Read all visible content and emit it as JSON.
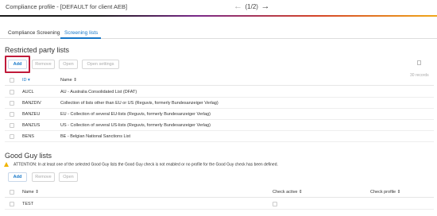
{
  "header": {
    "app_title": "Compliance profile - [DEFAULT for client AEB]",
    "pager": {
      "prev_icon": "arrow-left-icon",
      "label": "(1/2)",
      "next_icon": "arrow-right-icon"
    }
  },
  "tabs": [
    {
      "label": "Compliance Screening",
      "active": false
    },
    {
      "label": "Screening lists",
      "active": true
    }
  ],
  "restricted": {
    "title": "Restricted party lists",
    "buttons": {
      "add": "Add",
      "remove": "Remove",
      "open": "Open",
      "open_settings": "Open settings"
    },
    "records_label": "30 records",
    "columns": {
      "id": "ID",
      "name": "Name"
    },
    "rows": [
      {
        "id": "AUCL",
        "name": "AU - Australia Consolidated List (DFAT)"
      },
      {
        "id": "BANZDIV",
        "name": "Collection of lists other than EU or US (Reguvis, formerly Bundesanzeiger Verlag)"
      },
      {
        "id": "BANZEU",
        "name": "EU - Collection of several EU-lists (Reguvis, formerly Bundesanzeiger Verlag)"
      },
      {
        "id": "BANZUS",
        "name": "US - Collection of several US-lists (Reguvis, formerly Bundesanzeiger Verlag)"
      },
      {
        "id": "BENS",
        "name": "BE - Belgian National Sanctions List"
      }
    ]
  },
  "goodguy": {
    "title": "Good Guy lists",
    "warning": "ATTENTION: In at least one of the selected Good Guy lists the Good Guy check is not enabled or no profile for the Good Guy check has been defined.",
    "buttons": {
      "add": "Add",
      "remove": "Remove",
      "open": "Open"
    },
    "columns": {
      "name": "Name",
      "check_active": "Check active",
      "check_profile": "Check profile"
    },
    "rows": [
      {
        "name": "TEST",
        "check_active": false,
        "check_profile": ""
      }
    ]
  },
  "colors": {
    "accent": "#1677c8",
    "highlight": "#c01a3a",
    "warning": "#f0b400"
  }
}
